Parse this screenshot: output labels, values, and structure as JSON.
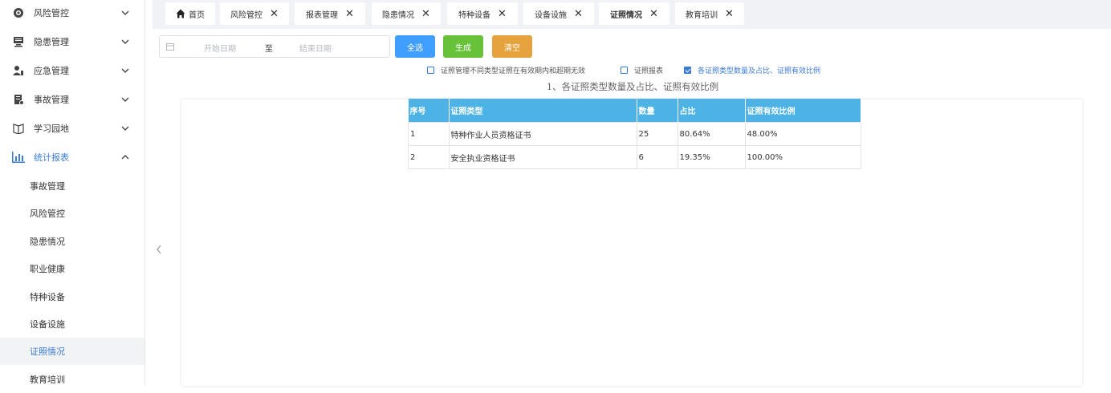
{
  "sidebar": {
    "menus": [
      {
        "label": "风险管控",
        "icon": "shield-gear-icon",
        "expanded": false
      },
      {
        "label": "隐患管理",
        "icon": "monitor-icon",
        "expanded": false
      },
      {
        "label": "应急管理",
        "icon": "user-alert-icon",
        "expanded": false
      },
      {
        "label": "事故管理",
        "icon": "report-doc-icon",
        "expanded": false
      },
      {
        "label": "学习园地",
        "icon": "book-icon",
        "expanded": false
      },
      {
        "label": "统计报表",
        "icon": "bar-chart-icon",
        "expanded": true
      }
    ],
    "submenu": [
      "事故管理",
      "风险管控",
      "隐患情况",
      "职业健康",
      "特种设备",
      "设备设施",
      "证照情况",
      "教育培训"
    ],
    "selected_submenu": "证照情况"
  },
  "tabs": [
    {
      "label": "首页",
      "closable": false,
      "active": false
    },
    {
      "label": "风险管控",
      "closable": true,
      "active": false
    },
    {
      "label": "报表管理",
      "closable": true,
      "active": false
    },
    {
      "label": "隐患情况",
      "closable": true,
      "active": false
    },
    {
      "label": "特种设备",
      "closable": true,
      "active": false
    },
    {
      "label": "设备设施",
      "closable": true,
      "active": false
    },
    {
      "label": "证照情况",
      "closable": true,
      "active": true
    },
    {
      "label": "教育培训",
      "closable": true,
      "active": false
    }
  ],
  "close_glyph": "✕",
  "toolbar": {
    "start_placeholder": "开始日期",
    "separator": "至",
    "end_placeholder": "结束日期",
    "select_all": "全选",
    "generate": "生成",
    "clear": "清空"
  },
  "options": [
    {
      "label": "证照管理不同类型证照在有效期内和超期无效",
      "checked": false
    },
    {
      "label": "证照报表",
      "checked": false
    },
    {
      "label": "各证照类型数量及占比、证照有效比例",
      "checked": true
    }
  ],
  "report": {
    "title": "1、各证照类型数量及占比、证照有效比例",
    "columns": [
      "序号",
      "证照类型",
      "数量",
      "占比",
      "证照有效比例"
    ],
    "rows": [
      [
        "1",
        "特种作业人员资格证书",
        "25",
        "80.64%",
        "48.00%"
      ],
      [
        "2",
        "安全执业资格证书",
        "6",
        "19.35%",
        "100.00%"
      ]
    ]
  },
  "colors": {
    "accent": "#3a7bd5",
    "table_header": "#4db3e6",
    "btn_select_all": "#409eff",
    "btn_generate": "#67c23a",
    "btn_clear": "#e6a23c"
  }
}
